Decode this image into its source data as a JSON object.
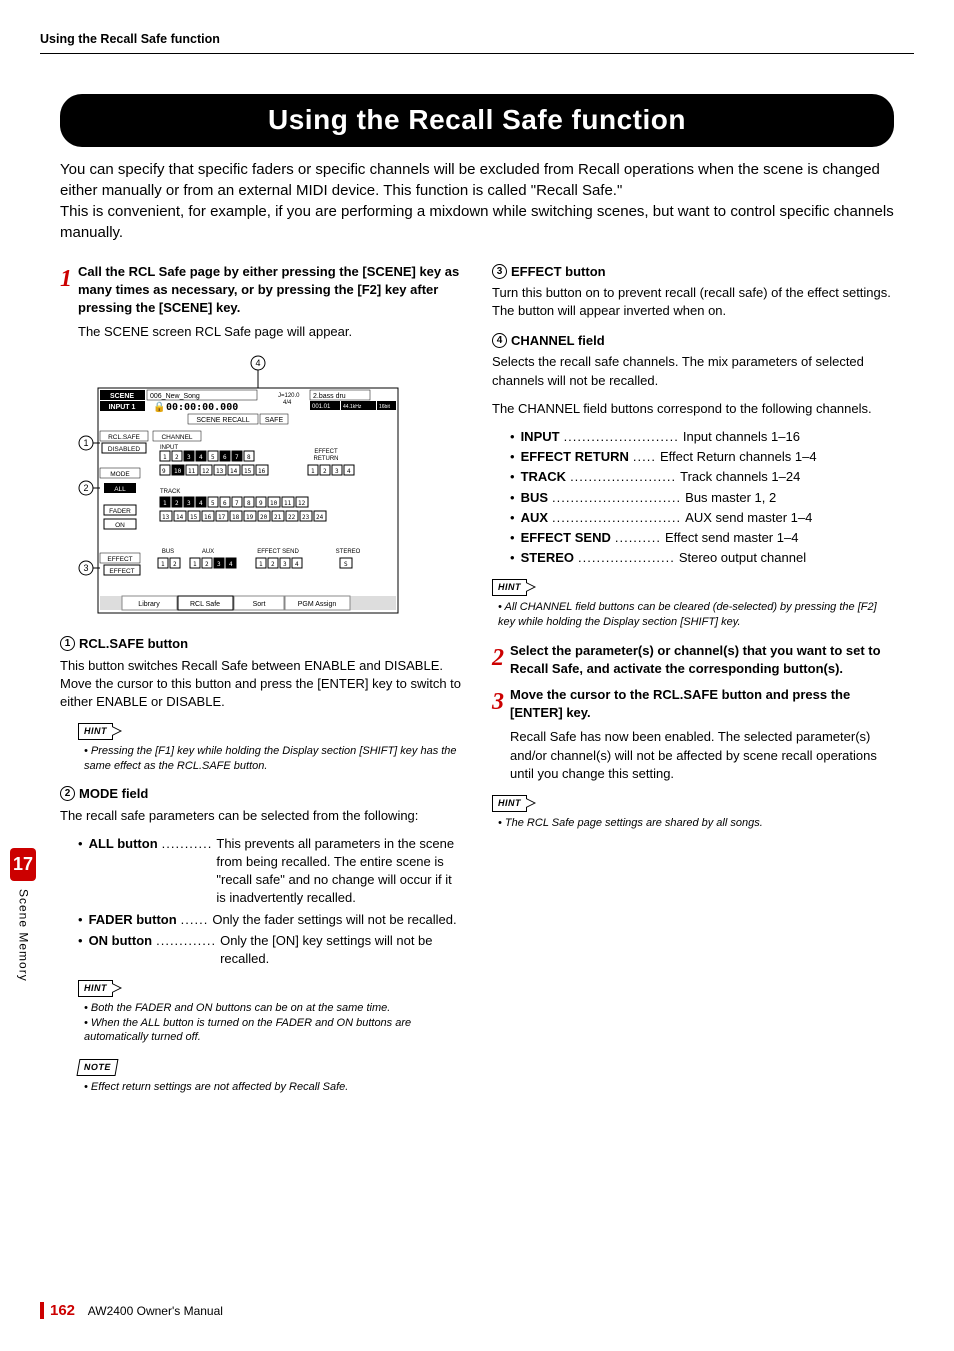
{
  "header": {
    "running_title": "Using the Recall Safe function"
  },
  "title": "Using the Recall Safe function",
  "intro_p1": "You can specify that specific faders or specific channels will be excluded from Recall operations when the scene is changed either manually or from an external MIDI device. This function is called \"Recall Safe.\"",
  "intro_p2": "This is convenient, for example, if you are performing a mixdown while switching scenes, but want to control specific channels manually.",
  "left": {
    "step1_head": "Call the RCL Safe page by either pressing the [SCENE] key as many times as necessary, or by pressing the [F2] key after pressing the [SCENE] key.",
    "step1_body": "The SCENE screen RCL Safe page will appear.",
    "sec1_num": "1",
    "sec1_title": "RCL.SAFE button",
    "sec1_body": "This button switches Recall Safe between ENABLE and DISABLE. Move the cursor to this button and press the [ENTER] key to switch to either ENABLE or DISABLE.",
    "hint1_label": "HINT",
    "hint1_text": "Pressing the [F1] key while holding the Display section [SHIFT] key has the same effect as the RCL.SAFE button.",
    "sec2_num": "2",
    "sec2_title": "MODE field",
    "sec2_body": "The recall safe parameters can be selected from the following:",
    "mode_items": [
      {
        "term": "ALL button",
        "dots": "...........",
        "desc": "This prevents all parameters in the scene from being recalled. The entire scene is \"recall safe\" and no change will occur if it is inadvertently recalled."
      },
      {
        "term": "FADER button",
        "dots": "......",
        "desc": "Only the fader settings will not be recalled."
      },
      {
        "term": "ON button",
        "dots": ".............",
        "desc": "Only the [ON] key settings will not be recalled."
      }
    ],
    "hint2_label": "HINT",
    "hint2_items": [
      "Both the FADER and ON buttons can be on at the same time.",
      "When the ALL button is turned on the FADER and ON buttons are automatically turned off."
    ],
    "note_label": "NOTE",
    "note_text": "Effect return settings are not affected by Recall Safe."
  },
  "right": {
    "sec3_num": "3",
    "sec3_title": "EFFECT button",
    "sec3_body": "Turn this button on to prevent recall (recall safe) of the effect settings. The button will appear inverted when on.",
    "sec4_num": "4",
    "sec4_title": "CHANNEL field",
    "sec4_body1": "Selects the recall safe channels. The mix parameters of selected channels will not be recalled.",
    "sec4_body2": "The CHANNEL field buttons correspond to the following channels.",
    "channel_items": [
      {
        "term": "INPUT",
        "dots": ".........................",
        "desc": "Input channels 1–16"
      },
      {
        "term": "EFFECT RETURN",
        "dots": ".....",
        "desc": "Effect Return channels 1–4"
      },
      {
        "term": "TRACK",
        "dots": ".......................",
        "desc": "Track channels 1–24"
      },
      {
        "term": "BUS",
        "dots": "............................",
        "desc": "Bus master 1, 2"
      },
      {
        "term": "AUX",
        "dots": "............................",
        "desc": "AUX send master 1–4"
      },
      {
        "term": "EFFECT SEND",
        "dots": "..........",
        "desc": "Effect send master 1–4"
      },
      {
        "term": "STEREO",
        "dots": ".....................",
        "desc": "Stereo output channel"
      }
    ],
    "hint3_label": "HINT",
    "hint3_text": "All CHANNEL field buttons can be cleared (de-selected) by pressing the [F2] key while holding the Display section [SHIFT] key.",
    "step2_head": "Select the parameter(s) or channel(s) that you want to set to Recall Safe, and activate the corresponding button(s).",
    "step3_head": "Move the cursor to the RCL.SAFE button and press the [ENTER] key.",
    "step3_body": "Recall Safe has now been enabled. The selected parameter(s) and/or channel(s) will not be affected by scene recall operations until you change this setting.",
    "hint4_label": "HINT",
    "hint4_text": "The RCL Safe page settings are shared by all songs."
  },
  "side": {
    "chapter_num": "17",
    "chapter_name": "Scene Memory"
  },
  "footer": {
    "page": "162",
    "manual": "AW2400  Owner's Manual"
  },
  "screenshot": {
    "callouts": [
      "1",
      "2",
      "3",
      "4"
    ],
    "header": {
      "scene": "SCENE",
      "input": "INPUT 1",
      "song": "006_New_Song",
      "time": "00:00:00.000",
      "tempo": "J=120.0",
      "sig": "4/4",
      "part": "2.bass dru",
      "bar": "001.01",
      "rate": "44.1kHz",
      "bit": "16bit",
      "recall": "SCENE RECALL",
      "safe": "SAFE"
    },
    "rcl_safe": {
      "label": "RCL.SAFE",
      "value": "DISABLED"
    },
    "mode": {
      "label": "MODE",
      "all": "ALL",
      "fader": "FADER",
      "on": "ON"
    },
    "effect": {
      "label": "EFFECT",
      "button": "EFFECT"
    },
    "channel": {
      "label": "CHANNEL",
      "input_label": "INPUT",
      "effect_return_label": "EFFECT RETURN",
      "track_label": "TRACK",
      "bus_label": "BUS",
      "aux_label": "AUX",
      "send_label": "EFFECT SEND",
      "stereo_label": "STEREO"
    },
    "tabs": [
      "Library",
      "RCL Safe",
      "Sort",
      "PGM Assign"
    ]
  }
}
